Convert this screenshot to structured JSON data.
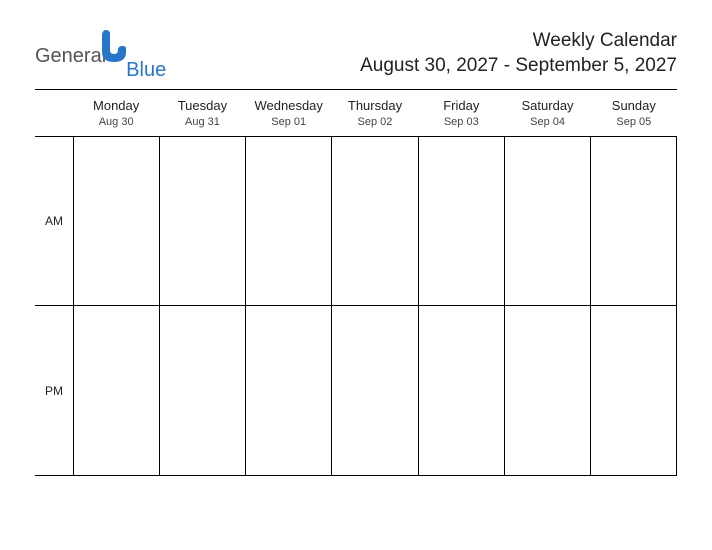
{
  "logo": {
    "part1": "General",
    "part2": "Blue"
  },
  "header": {
    "title": "Weekly Calendar",
    "date_range": "August 30, 2027 - September 5, 2027"
  },
  "days": [
    {
      "name": "Monday",
      "date": "Aug 30"
    },
    {
      "name": "Tuesday",
      "date": "Aug 31"
    },
    {
      "name": "Wednesday",
      "date": "Sep 01"
    },
    {
      "name": "Thursday",
      "date": "Sep 02"
    },
    {
      "name": "Friday",
      "date": "Sep 03"
    },
    {
      "name": "Saturday",
      "date": "Sep 04"
    },
    {
      "name": "Sunday",
      "date": "Sep 05"
    }
  ],
  "periods": [
    {
      "label": "AM"
    },
    {
      "label": "PM"
    }
  ]
}
